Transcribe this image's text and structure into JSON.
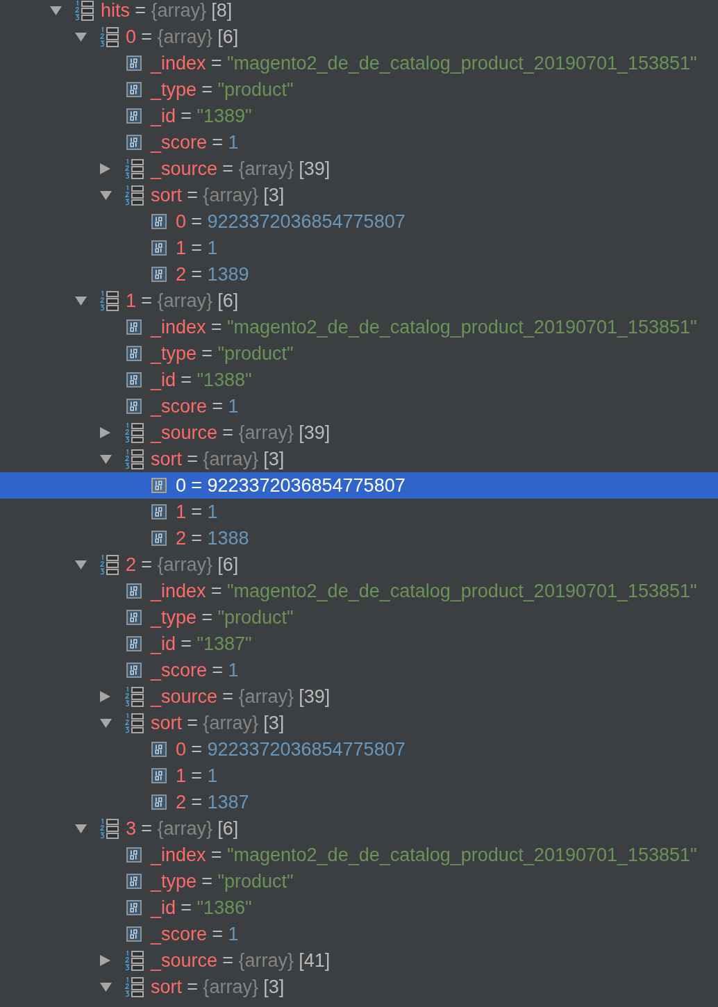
{
  "tree": [
    {
      "name": "hits",
      "sep": "=",
      "kind": "array",
      "type": "{array}",
      "size": "[8]",
      "expanded": true,
      "selected": false,
      "children": [
        {
          "name": "0",
          "sep": "=",
          "kind": "array",
          "type": "{array}",
          "size": "[6]",
          "expanded": true,
          "selected": false,
          "children": [
            {
              "name": "_index",
              "sep": "=",
              "kind": "string",
              "value": "\"magento2_de_de_catalog_product_20190701_153851\"",
              "selected": false
            },
            {
              "name": "_type",
              "sep": "=",
              "kind": "string",
              "value": "\"product\"",
              "selected": false
            },
            {
              "name": "_id",
              "sep": "=",
              "kind": "string",
              "value": "\"1389\"",
              "selected": false
            },
            {
              "name": "_score",
              "sep": "=",
              "kind": "number",
              "value": "1",
              "selected": false
            },
            {
              "name": "_source",
              "sep": "=",
              "kind": "array",
              "type": "{array}",
              "size": "[39]",
              "expanded": false,
              "selected": false
            },
            {
              "name": "sort",
              "sep": "=",
              "kind": "array",
              "type": "{array}",
              "size": "[3]",
              "expanded": true,
              "selected": false,
              "children": [
                {
                  "name": "0",
                  "sep": "=",
                  "kind": "number",
                  "value": "9223372036854775807",
                  "selected": false
                },
                {
                  "name": "1",
                  "sep": "=",
                  "kind": "number",
                  "value": "1",
                  "selected": false
                },
                {
                  "name": "2",
                  "sep": "=",
                  "kind": "number",
                  "value": "1389",
                  "selected": false
                }
              ]
            }
          ]
        },
        {
          "name": "1",
          "sep": "=",
          "kind": "array",
          "type": "{array}",
          "size": "[6]",
          "expanded": true,
          "selected": false,
          "children": [
            {
              "name": "_index",
              "sep": "=",
              "kind": "string",
              "value": "\"magento2_de_de_catalog_product_20190701_153851\"",
              "selected": false
            },
            {
              "name": "_type",
              "sep": "=",
              "kind": "string",
              "value": "\"product\"",
              "selected": false
            },
            {
              "name": "_id",
              "sep": "=",
              "kind": "string",
              "value": "\"1388\"",
              "selected": false
            },
            {
              "name": "_score",
              "sep": "=",
              "kind": "number",
              "value": "1",
              "selected": false
            },
            {
              "name": "_source",
              "sep": "=",
              "kind": "array",
              "type": "{array}",
              "size": "[39]",
              "expanded": false,
              "selected": false
            },
            {
              "name": "sort",
              "sep": "=",
              "kind": "array",
              "type": "{array}",
              "size": "[3]",
              "expanded": true,
              "selected": false,
              "children": [
                {
                  "name": "0",
                  "sep": "=",
                  "kind": "number",
                  "value": "9223372036854775807",
                  "selected": true
                },
                {
                  "name": "1",
                  "sep": "=",
                  "kind": "number",
                  "value": "1",
                  "selected": false
                },
                {
                  "name": "2",
                  "sep": "=",
                  "kind": "number",
                  "value": "1388",
                  "selected": false
                }
              ]
            }
          ]
        },
        {
          "name": "2",
          "sep": "=",
          "kind": "array",
          "type": "{array}",
          "size": "[6]",
          "expanded": true,
          "selected": false,
          "children": [
            {
              "name": "_index",
              "sep": "=",
              "kind": "string",
              "value": "\"magento2_de_de_catalog_product_20190701_153851\"",
              "selected": false
            },
            {
              "name": "_type",
              "sep": "=",
              "kind": "string",
              "value": "\"product\"",
              "selected": false
            },
            {
              "name": "_id",
              "sep": "=",
              "kind": "string",
              "value": "\"1387\"",
              "selected": false
            },
            {
              "name": "_score",
              "sep": "=",
              "kind": "number",
              "value": "1",
              "selected": false
            },
            {
              "name": "_source",
              "sep": "=",
              "kind": "array",
              "type": "{array}",
              "size": "[39]",
              "expanded": false,
              "selected": false
            },
            {
              "name": "sort",
              "sep": "=",
              "kind": "array",
              "type": "{array}",
              "size": "[3]",
              "expanded": true,
              "selected": false,
              "children": [
                {
                  "name": "0",
                  "sep": "=",
                  "kind": "number",
                  "value": "9223372036854775807",
                  "selected": false
                },
                {
                  "name": "1",
                  "sep": "=",
                  "kind": "number",
                  "value": "1",
                  "selected": false
                },
                {
                  "name": "2",
                  "sep": "=",
                  "kind": "number",
                  "value": "1387",
                  "selected": false
                }
              ]
            }
          ]
        },
        {
          "name": "3",
          "sep": "=",
          "kind": "array",
          "type": "{array}",
          "size": "[6]",
          "expanded": true,
          "selected": false,
          "children": [
            {
              "name": "_index",
              "sep": "=",
              "kind": "string",
              "value": "\"magento2_de_de_catalog_product_20190701_153851\"",
              "selected": false
            },
            {
              "name": "_type",
              "sep": "=",
              "kind": "string",
              "value": "\"product\"",
              "selected": false
            },
            {
              "name": "_id",
              "sep": "=",
              "kind": "string",
              "value": "\"1386\"",
              "selected": false
            },
            {
              "name": "_score",
              "sep": "=",
              "kind": "number",
              "value": "1",
              "selected": false
            },
            {
              "name": "_source",
              "sep": "=",
              "kind": "array",
              "type": "{array}",
              "size": "[41]",
              "expanded": false,
              "selected": false
            },
            {
              "name": "sort",
              "sep": "=",
              "kind": "array",
              "type": "{array}",
              "size": "[3]",
              "expanded": true,
              "selected": false
            }
          ]
        }
      ]
    }
  ]
}
